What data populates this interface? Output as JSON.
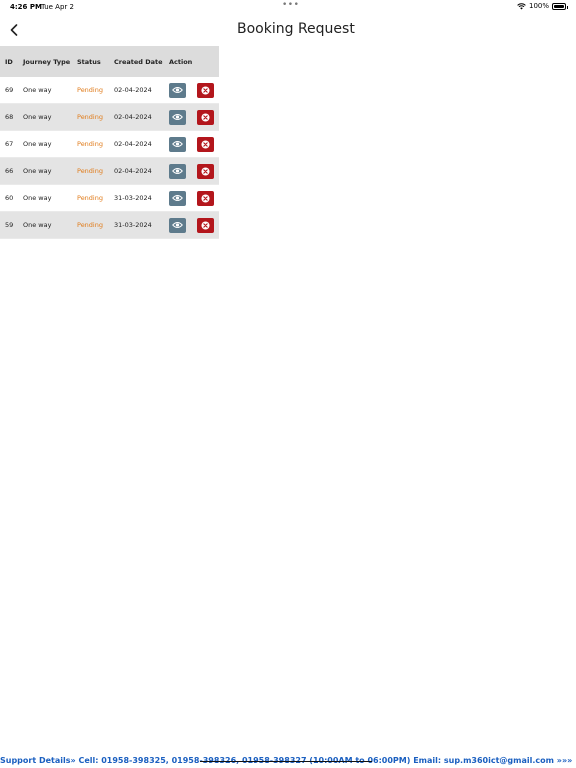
{
  "status_bar": {
    "time": "4:26 PM",
    "date": "Tue Apr 2",
    "battery": "100%"
  },
  "header": {
    "title": "Booking Request"
  },
  "table": {
    "columns": [
      "ID",
      "Journey Type",
      "Status",
      "Created Date",
      "Action"
    ],
    "rows": [
      {
        "id": "69",
        "type": "One way",
        "status": "Pending",
        "date": "02-04-2024"
      },
      {
        "id": "68",
        "type": "One way",
        "status": "Pending",
        "date": "02-04-2024"
      },
      {
        "id": "67",
        "type": "One way",
        "status": "Pending",
        "date": "02-04-2024"
      },
      {
        "id": "66",
        "type": "One way",
        "status": "Pending",
        "date": "02-04-2024"
      },
      {
        "id": "60",
        "type": "One way",
        "status": "Pending",
        "date": "31-03-2024"
      },
      {
        "id": "59",
        "type": "One way",
        "status": "Pending",
        "date": "31-03-2024"
      }
    ]
  },
  "footer": {
    "text": "Support Details» Cell: 01958-398325, 01958-398326, 01958-398327 (10:00AM to 06:00PM) Email: sup.m360ict@gmail.com »»»"
  },
  "colors": {
    "pending": "#e07b1a",
    "view_button": "#5e7b8c",
    "cancel_button": "#b3161c",
    "footer_text": "#1a5fc0",
    "header_row": "#dcdcdc"
  }
}
